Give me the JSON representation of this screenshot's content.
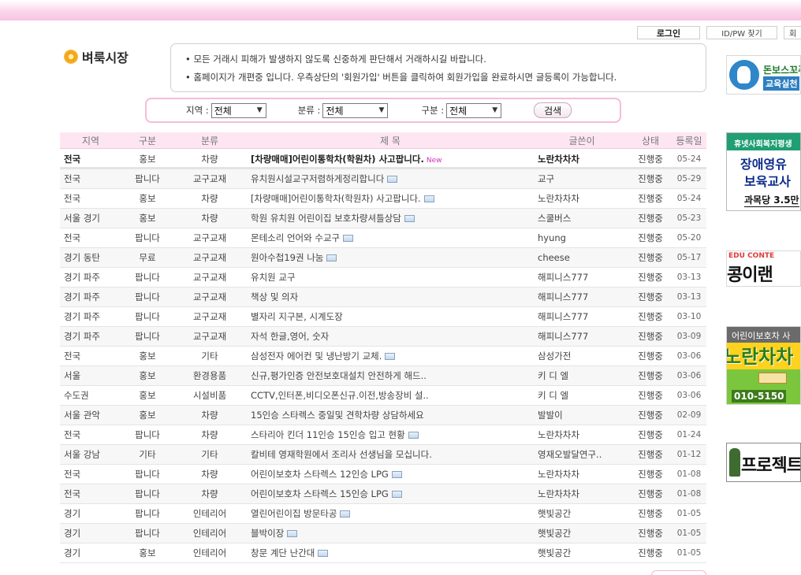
{
  "top_links": {
    "login": "로그인",
    "idpw": "ID/PW 찾기",
    "join": "회"
  },
  "logo": {
    "text": "벼룩시장"
  },
  "notice": [
    "모든 거래시 피해가 발생하지 않도록 신중하게 판단해서 거래하시길 바랍니다.",
    "홈페이지가 개편중 입니다. 우측상단의 '회원가입' 버튼을 클릭하여 회원가입을 완료하시면 글등록이 가능합니다."
  ],
  "filters": {
    "region_label": "지역 :",
    "region_value": "전체",
    "category_label": "분류 :",
    "category_value": "전체",
    "kind_label": "구분 :",
    "kind_value": "전체",
    "search_label": "검색"
  },
  "columns": [
    "지역",
    "구분",
    "분류",
    "제 목",
    "글쓴이",
    "상태",
    "등록일"
  ],
  "featured": {
    "region": "전국",
    "kind": "홍보",
    "category": "차량",
    "title": "[차량매매]어린이통학차(학원차) 사고팝니다.",
    "new": "New",
    "author": "노란차차차",
    "status": "진행중",
    "date": "05-24"
  },
  "rows": [
    {
      "region": "전국",
      "kind": "팝니다",
      "category": "교구교재",
      "title": "유치원시설교구저렴하게정리합니다",
      "img": true,
      "author": "교구",
      "status": "진행중",
      "date": "05-29"
    },
    {
      "region": "전국",
      "kind": "홍보",
      "category": "차량",
      "title": "[차량매매]어린이통학차(학원차) 사고팝니다.",
      "img": true,
      "author": "노란차차차",
      "status": "진행중",
      "date": "05-24"
    },
    {
      "region": "서울 경기",
      "kind": "홍보",
      "category": "차량",
      "title": "학원 유치원 어린이집 보호차량셔틀상담",
      "img": true,
      "author": "스쿨버스",
      "status": "진행중",
      "date": "05-23"
    },
    {
      "region": "전국",
      "kind": "팝니다",
      "category": "교구교재",
      "title": "몬테소리 언어와 수교구",
      "img": true,
      "author": "hyung",
      "status": "진행중",
      "date": "05-20"
    },
    {
      "region": "경기 동탄",
      "kind": "무료",
      "category": "교구교재",
      "title": "원아수첩19권 나눔",
      "img": true,
      "author": "cheese",
      "status": "진행중",
      "date": "05-17"
    },
    {
      "region": "경기 파주",
      "kind": "팝니다",
      "category": "교구교재",
      "title": "유치원 교구",
      "img": false,
      "author": "해피니스777",
      "status": "진행중",
      "date": "03-13"
    },
    {
      "region": "경기 파주",
      "kind": "팝니다",
      "category": "교구교재",
      "title": "책상 및 의자",
      "img": false,
      "author": "해피니스777",
      "status": "진행중",
      "date": "03-13"
    },
    {
      "region": "경기 파주",
      "kind": "팝니다",
      "category": "교구교재",
      "title": "별자리 지구본, 시계도장",
      "img": false,
      "author": "해피니스777",
      "status": "진행중",
      "date": "03-10"
    },
    {
      "region": "경기 파주",
      "kind": "팝니다",
      "category": "교구교재",
      "title": "자석 한글,영어, 숫자",
      "img": false,
      "author": "해피니스777",
      "status": "진행중",
      "date": "03-09"
    },
    {
      "region": "전국",
      "kind": "홍보",
      "category": "기타",
      "title": "삼성전자 에어컨 및 냉난방기 교체.",
      "img": true,
      "author": "삼성가전",
      "status": "진행중",
      "date": "03-06"
    },
    {
      "region": "서울",
      "kind": "홍보",
      "category": "환경용품",
      "title": "신규,평가인증 안전보호대설치 안전하게 해드..",
      "img": false,
      "author": "키 디 엘",
      "status": "진행중",
      "date": "03-06"
    },
    {
      "region": "수도권",
      "kind": "홍보",
      "category": "시설비품",
      "title": "CCTV,인터폰,비디오폰신규.이전,방송장비 설..",
      "img": false,
      "author": "키 디 엘",
      "status": "진행중",
      "date": "03-06"
    },
    {
      "region": "서울 관악",
      "kind": "홍보",
      "category": "차량",
      "title": "15인승 스타렉스 중일및 견학차량 상담하세요",
      "img": false,
      "author": "발발이",
      "status": "진행중",
      "date": "02-09"
    },
    {
      "region": "전국",
      "kind": "팝니다",
      "category": "차량",
      "title": "스타리아 킨더 11인승 15인승 입고 현황",
      "img": true,
      "author": "노란차차차",
      "status": "진행중",
      "date": "01-24"
    },
    {
      "region": "서울 강남",
      "kind": "기타",
      "category": "기타",
      "title": "칼비테 영재학원에서 조리사 선생님을 모십니다.",
      "img": false,
      "author": "영재오발달연구..",
      "status": "진행중",
      "date": "01-12"
    },
    {
      "region": "전국",
      "kind": "팝니다",
      "category": "차량",
      "title": "어린이보호차 스타렉스 12인승 LPG",
      "img": true,
      "author": "노란차차차",
      "status": "진행중",
      "date": "01-08"
    },
    {
      "region": "전국",
      "kind": "팝니다",
      "category": "차량",
      "title": "어린이보호차 스타렉스 15인승 LPG",
      "img": true,
      "author": "노란차차차",
      "status": "진행중",
      "date": "01-08"
    },
    {
      "region": "경기",
      "kind": "팝니다",
      "category": "인테리어",
      "title": "열린어린이집 방문타공",
      "img": true,
      "author": "햇빛공간",
      "status": "진행중",
      "date": "01-05"
    },
    {
      "region": "경기",
      "kind": "팝니다",
      "category": "인테리어",
      "title": "블박이장",
      "img": true,
      "author": "햇빛공간",
      "status": "진행중",
      "date": "01-05"
    },
    {
      "region": "경기",
      "kind": "홍보",
      "category": "인테리어",
      "title": "창문 계단 난간대",
      "img": true,
      "author": "햇빛공간",
      "status": "진행중",
      "date": "01-05"
    }
  ],
  "banners": {
    "b1_line1": "돈보스꼬푸",
    "b1_line2": "교육실천",
    "b2_head": "휴넷사회복지평생",
    "b2_line1": "장애영유",
    "b2_line2": "보육교사",
    "b2_line3": "과목당 3.5만",
    "b3_edu": "EDU",
    "b3_edu2": "CONTE",
    "b3_text": "콩이랜",
    "b4_sky": "어린이보호차 사",
    "b4_big": "노란차차",
    "b4_phone": "010-5150",
    "b5_text": "프로젝트 접"
  }
}
